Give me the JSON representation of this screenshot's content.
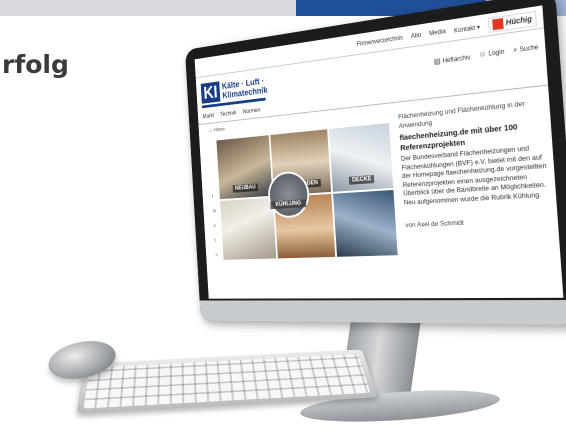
{
  "headline": "rfolg",
  "topnav": {
    "links": [
      "Firmenverzeichnis",
      "Abo",
      "Media",
      "Kontakt ▾"
    ],
    "partner_logo": "Hüchig"
  },
  "brand": {
    "ki": "KI",
    "line1": "Kälte · Luft ·",
    "line2": "Klimatechnik"
  },
  "header_links": {
    "heftarchiv": "Heftarchiv",
    "login": "Login",
    "suche": "Suche"
  },
  "menu": [
    "Markt",
    "Technik",
    "Normen"
  ],
  "breadcrumb": {
    "home": "Home"
  },
  "collage": {
    "labels": [
      "NEUBAU",
      "FUSSBODEN",
      "DECKE",
      "KÜHLUNG"
    ]
  },
  "article": {
    "kicker": "Flächenheizung und Flächenkühlung in der Anwendung",
    "title": "flaechenheizung.de mit über 100 Referenzprojekten",
    "body": "Der Bundesverband Flächenheizungen und Flächenkühlungen (BVF) e.V. bietet mit den auf der Homepage flaechenheizung.de vorgestellten Referenzprojekten einen ausgezeichneten Überblick über die Bandbreite an Möglichkeiten. Neu aufgenommen wurde die Rubrik Kühlung.",
    "author": "von Axel de Schmidt"
  }
}
